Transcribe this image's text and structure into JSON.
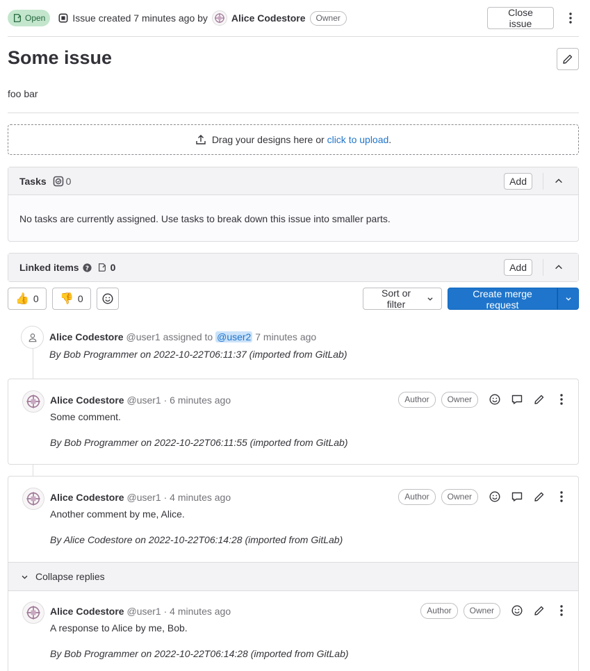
{
  "header": {
    "status": "Open",
    "created_text": "Issue created 7 minutes ago by",
    "author": "Alice Codestore",
    "author_role": "Owner",
    "close_label": "Close issue"
  },
  "issue": {
    "title": "Some issue",
    "description": "foo bar"
  },
  "design_upload": {
    "text": "Drag your designs here or",
    "link": "click to upload",
    "suffix": "."
  },
  "tasks": {
    "title": "Tasks",
    "count": "0",
    "add_label": "Add",
    "empty_text": "No tasks are currently assigned. Use tasks to break down this issue into smaller parts."
  },
  "linked_items": {
    "title": "Linked items",
    "count": "0",
    "add_label": "Add"
  },
  "reactions": {
    "thumbs_up": "0",
    "thumbs_down": "0"
  },
  "toolbar": {
    "sort_label": "Sort or filter",
    "create_mr_label": "Create merge request"
  },
  "system_note": {
    "author": "Alice Codestore",
    "username": "@user1",
    "action": "assigned to",
    "mention": "@user2",
    "time": "7 minutes ago",
    "imported": "By Bob Programmer on 2022-10-22T06:11:37 (imported from GitLab)"
  },
  "notes": [
    {
      "author": "Alice Codestore",
      "meta": "@user1 · 6 minutes ago",
      "body": "Some comment.",
      "imported": "By Bob Programmer on 2022-10-22T06:11:55 (imported from GitLab)",
      "badges": [
        "Author",
        "Owner"
      ]
    },
    {
      "author": "Alice Codestore",
      "meta": "@user1 · 4 minutes ago",
      "body": "Another comment by me, Alice.",
      "imported": "By Alice Codestore on 2022-10-22T06:14:28 (imported from GitLab)",
      "badges": [
        "Author",
        "Owner"
      ]
    }
  ],
  "collapse_label": "Collapse replies",
  "reply": {
    "author": "Alice Codestore",
    "meta": "@user1 · 4 minutes ago",
    "body": "A response to Alice by me, Bob.",
    "imported": "By Bob Programmer on 2022-10-22T06:14:28 (imported from GitLab)",
    "badges": [
      "Author",
      "Owner"
    ]
  },
  "colors": {
    "accent": "#1f75cb",
    "open_bg": "#c3e6cd",
    "open_text": "#24663b"
  }
}
